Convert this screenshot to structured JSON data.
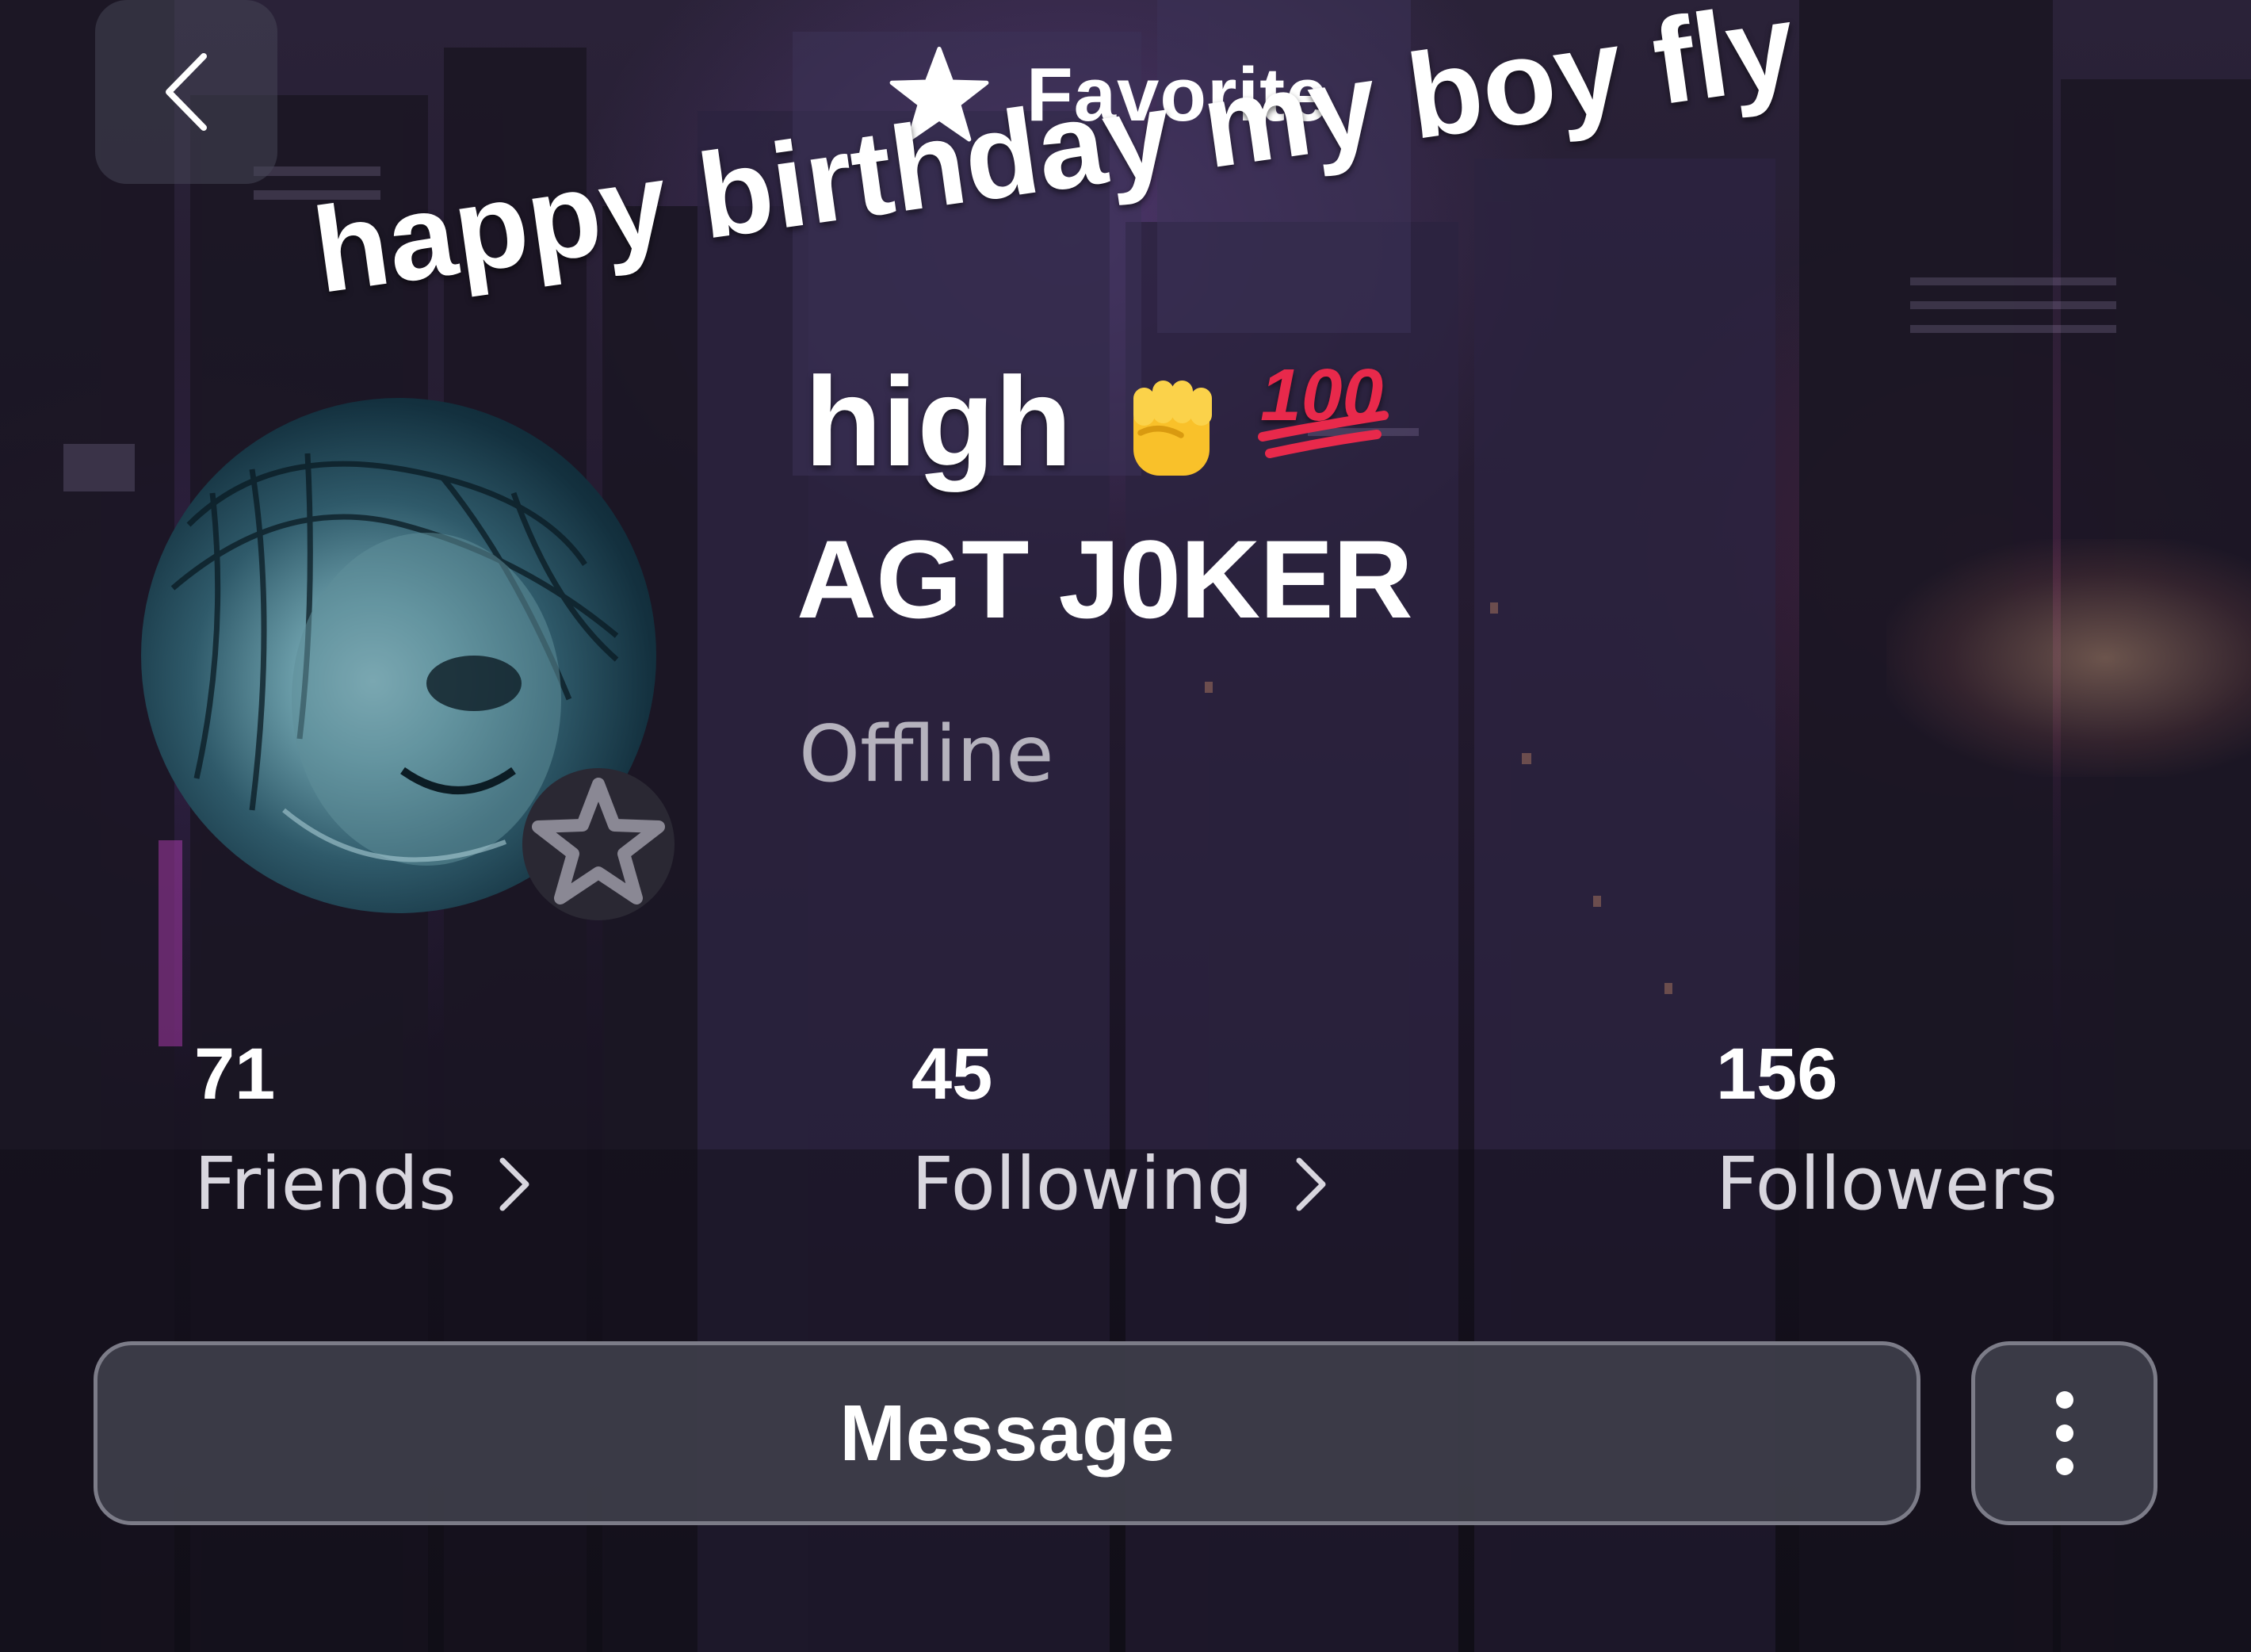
{
  "header": {
    "back_icon": "chevron-left-icon",
    "favorite_icon": "star-filled-icon",
    "favorite_label": "Favorite"
  },
  "overlay_caption": {
    "line1": "happy birthday my boy fly",
    "line2": "high",
    "emojis": [
      "raised-fist-emoji",
      "hundred-points-emoji"
    ]
  },
  "profile": {
    "username": "AGT J0KER",
    "status": "Offline",
    "avatar_badge_icon": "star-outline-icon"
  },
  "stats": [
    {
      "count": "71",
      "label": "Friends",
      "has_chevron": true
    },
    {
      "count": "45",
      "label": "Following",
      "has_chevron": true
    },
    {
      "count": "156",
      "label": "Followers",
      "has_chevron": false
    }
  ],
  "actions": {
    "message_label": "Message",
    "more_icon": "more-vertical-icon"
  },
  "colors": {
    "button_bg": "#3e3e4a",
    "button_border": "#7c7c88",
    "status_text": "#b5b2bd",
    "hundred_red": "#e8294b",
    "fist_yellow": "#f9c12a"
  }
}
